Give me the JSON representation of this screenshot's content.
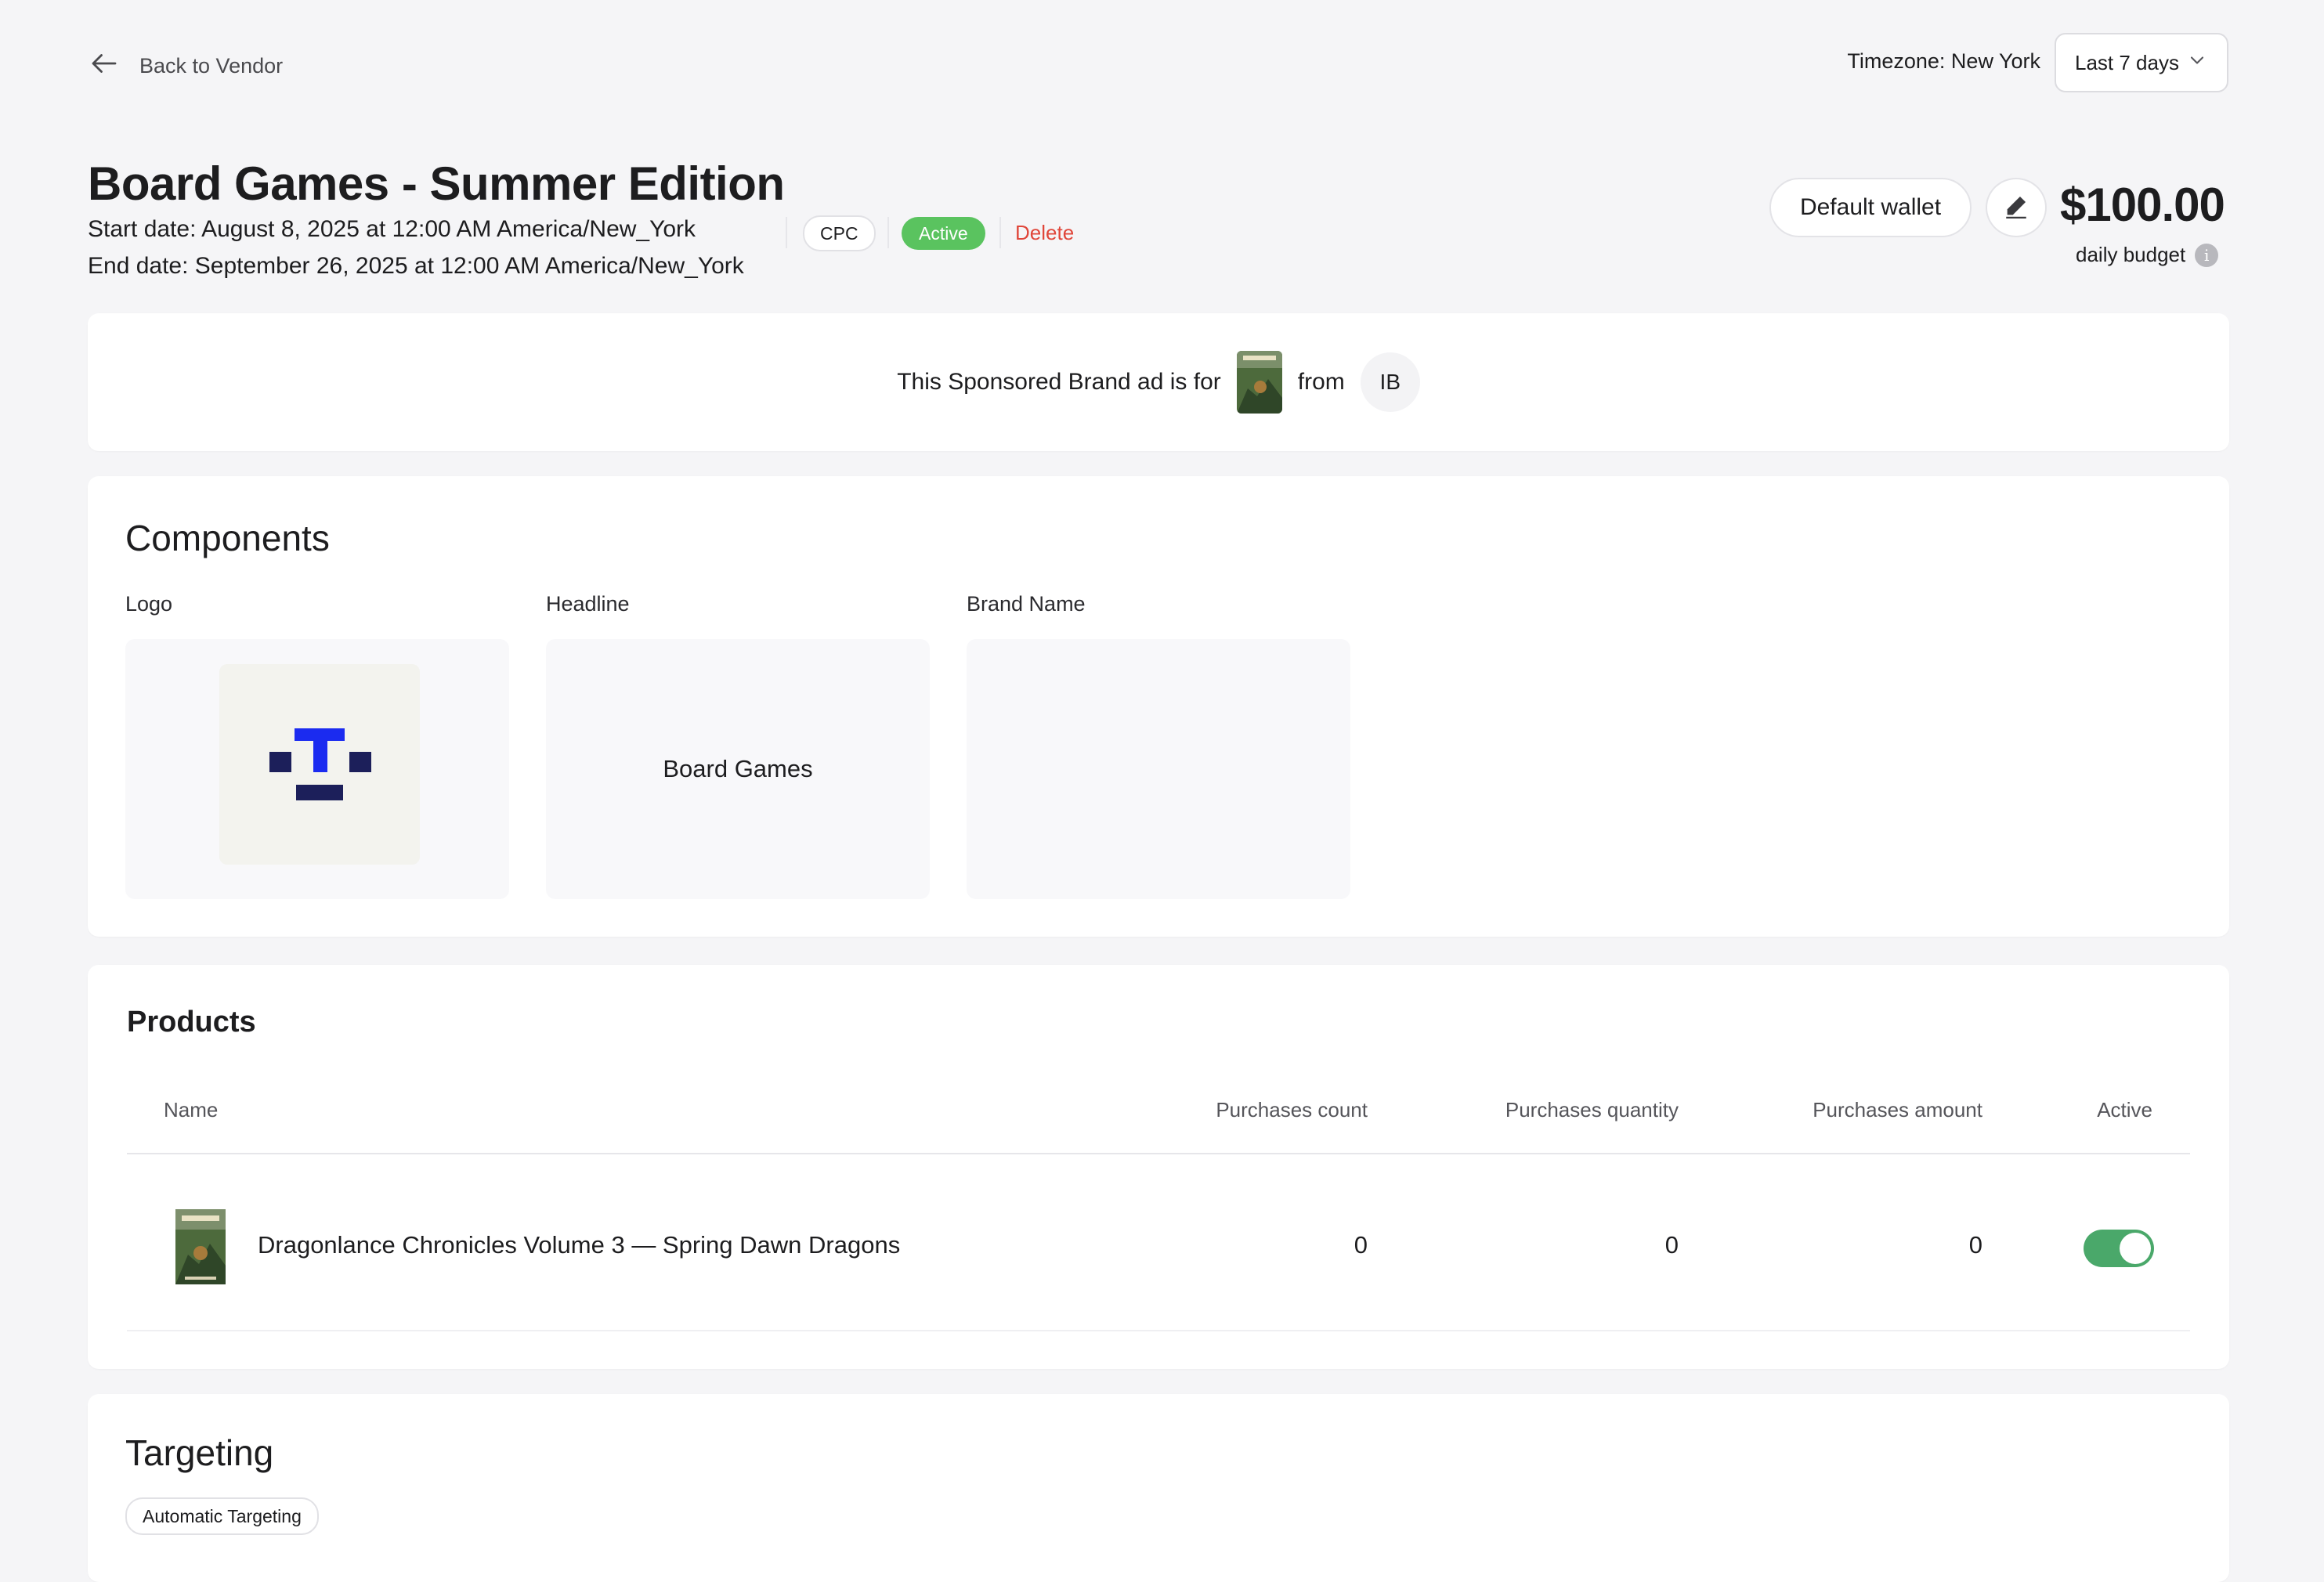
{
  "nav": {
    "back_label": "Back to Vendor"
  },
  "timezone": {
    "label": "Timezone: New York"
  },
  "date_range": {
    "selected": "Last 7 days"
  },
  "campaign": {
    "title": "Board Games - Summer Edition",
    "start_date": "Start date: August 8, 2025 at 12:00 AM America/New_York",
    "end_date": "End date: September 26, 2025 at 12:00 AM America/New_York",
    "billing_badge": "CPC",
    "status_badge": "Active",
    "delete_label": "Delete"
  },
  "budget": {
    "wallet_label": "Default wallet",
    "amount": "$100.00",
    "label": "daily budget",
    "info_icon": "i"
  },
  "sponsor_banner": {
    "prefix": "This Sponsored Brand ad is for",
    "middle": "from",
    "vendor_initials": "IB"
  },
  "components": {
    "title": "Components",
    "logo_label": "Logo",
    "headline_label": "Headline",
    "headline_value": "Board Games",
    "brand_name_label": "Brand Name"
  },
  "products": {
    "title": "Products",
    "columns": [
      "Name",
      "Purchases count",
      "Purchases quantity",
      "Purchases amount",
      "Active"
    ],
    "rows": [
      {
        "name": "Dragonlance Chronicles Volume 3 — Spring Dawn Dragons",
        "count": "0",
        "quantity": "0",
        "amount": "0",
        "active": true
      }
    ]
  },
  "targeting": {
    "title": "Targeting",
    "chip": "Automatic Targeting"
  },
  "colors": {
    "active_badge": "#5ac35f",
    "toggle_on": "#4aa86a",
    "delete": "#e0463a",
    "logo_blue": "#1b2bf0",
    "logo_navy": "#1c1f5a"
  }
}
